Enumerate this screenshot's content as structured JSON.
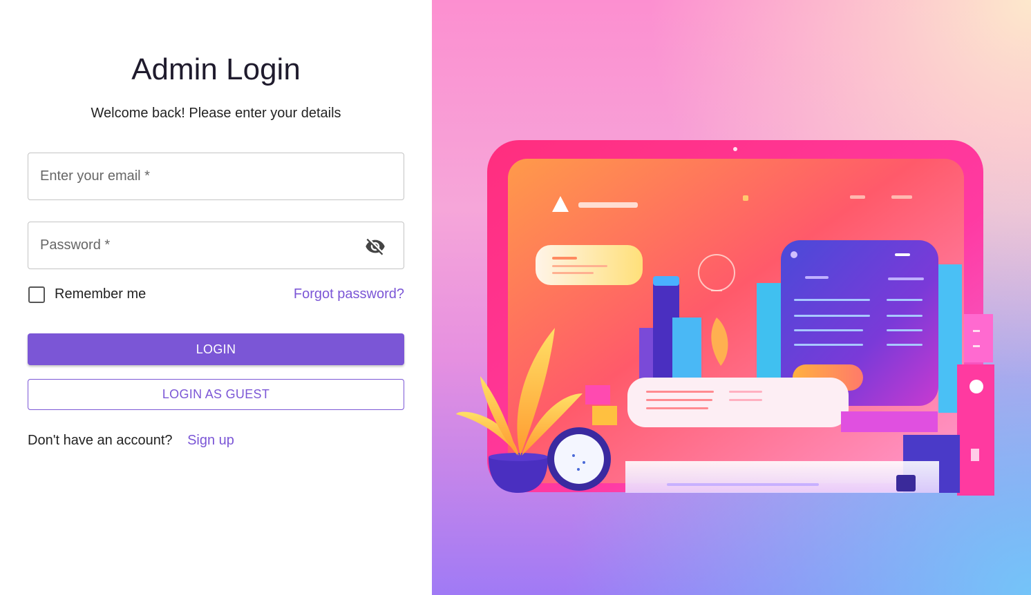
{
  "login": {
    "title": "Admin Login",
    "subtitle": "Welcome back! Please enter your details",
    "email_placeholder": "Enter your email *",
    "password_placeholder": "Password *",
    "remember_label": "Remember me",
    "forgot_label": "Forgot password?",
    "login_button": "LOGIN",
    "guest_button": "LOGIN AS GUEST",
    "signup_prompt": "Don't have an account?",
    "signup_link": "Sign up"
  },
  "icons": {
    "password_toggle": "eye-off-icon"
  },
  "colors": {
    "accent": "#7b56d6",
    "text": "#222222",
    "border": "#c4c4c4"
  }
}
